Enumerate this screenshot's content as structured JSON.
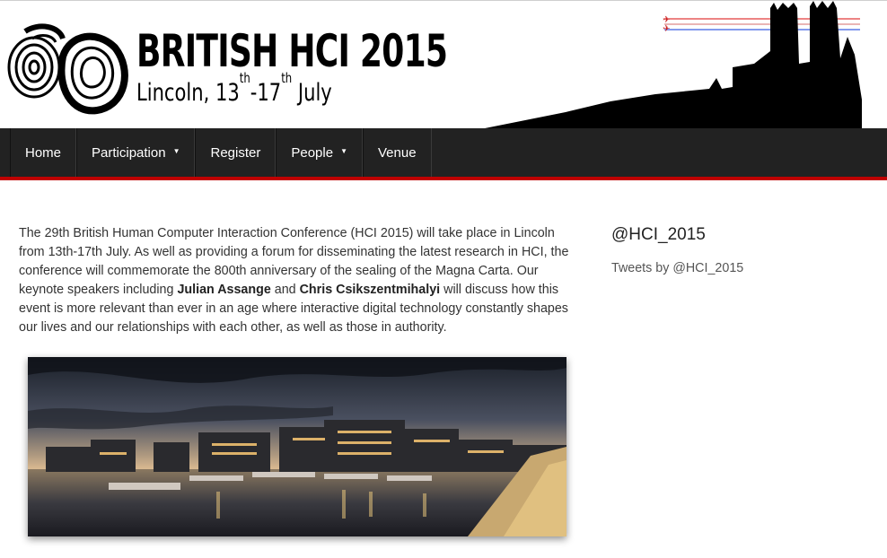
{
  "header": {
    "title": "BRITISH HCI 2015",
    "subtitle_city": "Lincoln, 13",
    "subtitle_sup1": "th",
    "subtitle_dash": "-17",
    "subtitle_sup2": "th",
    "subtitle_month": " July",
    "logo_icon": "hci-logo-icon",
    "skyline_icon": "lincoln-cathedral-icon"
  },
  "nav": {
    "items": [
      {
        "label": "Home",
        "has_dropdown": false
      },
      {
        "label": "Participation",
        "has_dropdown": true
      },
      {
        "label": "Register",
        "has_dropdown": false
      },
      {
        "label": "People",
        "has_dropdown": true
      },
      {
        "label": "Venue",
        "has_dropdown": false
      }
    ],
    "caret": "▼"
  },
  "main": {
    "intro_1": "The 29th British Human Computer Interaction Conference (HCI 2015) will take place in Lincoln from 13th-17th July. As well as providing a forum for disseminating the latest research in HCI, the conference will commemorate the 800th anniversary of the sealing of the Magna Carta. Our keynote speakers including ",
    "keynote_1": "Julian Assange",
    "and": " and ",
    "keynote_2": "Chris Csikszentmihalyi",
    "intro_2": " will discuss how this event is more relevant than ever in an age where interactive digital technology constantly shapes our lives and our relationships with each other, as well as those in authority.",
    "photo_icon": "lincoln-waterfront-photo"
  },
  "sidebar": {
    "title": "@HCI_2015",
    "tweets_link": "Tweets by @HCI_2015"
  },
  "colors": {
    "navbar": "#222222",
    "accent": "#c00000",
    "text": "#333333"
  }
}
